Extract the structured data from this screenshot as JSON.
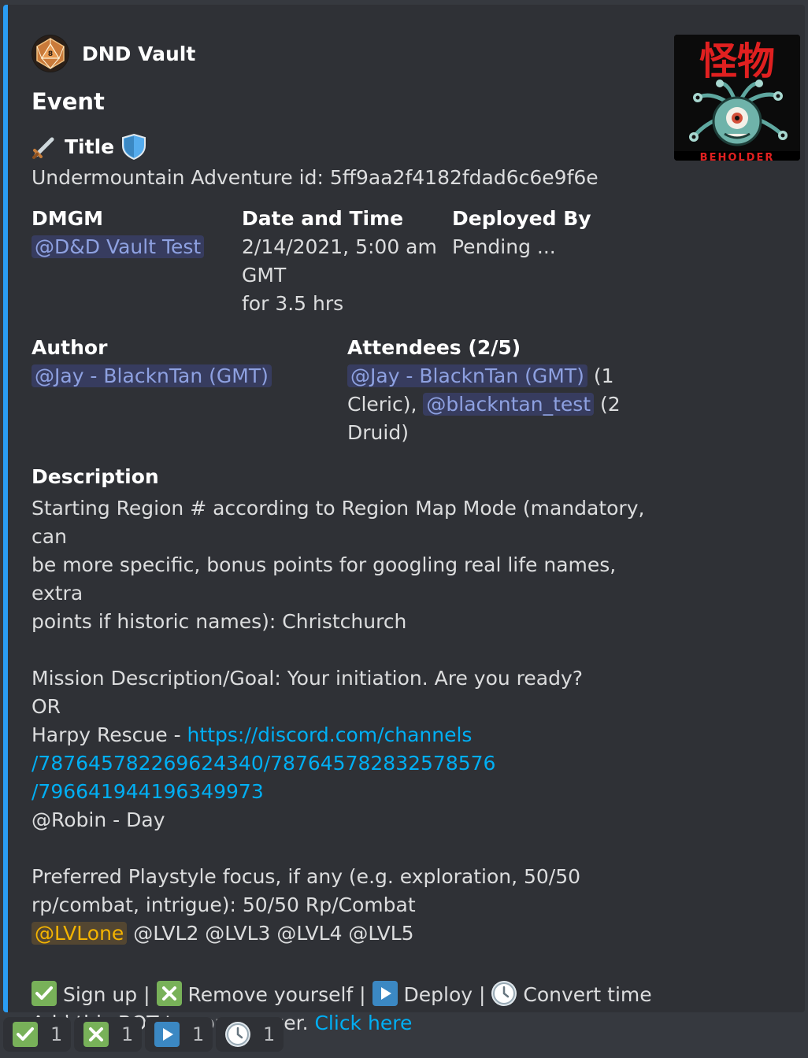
{
  "embed": {
    "accent_color": "#2a9df4",
    "author_name": "DND Vault",
    "author_icon": "d20-dice-icon",
    "title": "Event",
    "thumbnail_icon": "beholder-image",
    "thumbnail_text": "怪物",
    "thumbnail_caption": "BEHOLDER",
    "title_field": {
      "name": "Title",
      "value": "Undermountain Adventure id: 5ff9aa2f4182fdad6c6e9f6e"
    },
    "dmgm": {
      "name": "DMGM",
      "value": "@D&D Vault Test"
    },
    "date_time": {
      "name": "Date and Time",
      "line1": "2/14/2021, 5:00 am",
      "line2": "GMT",
      "line3": "for 3.5 hrs"
    },
    "deployed_by": {
      "name": "Deployed By",
      "value": "Pending ..."
    },
    "author_field": {
      "name": "Author",
      "value": "@Jay - BlacknTan (GMT)"
    },
    "attendees": {
      "name": "Attendees (2/5)",
      "m1": "@Jay - BlacknTan (GMT)",
      "t1a": "(1",
      "t1b": "Cleric),",
      "m2": "@blackntan_test",
      "t2a": "(2",
      "t2b": "Druid)"
    },
    "description": {
      "name": "Description",
      "l1": "Starting Region # according to Region Map Mode (mandatory, can",
      "l2": "be more specific, bonus points for googling real life names, extra",
      "l3": "points if historic names): Christchurch",
      "l4": "Mission Description/Goal: Your initiation. Are you ready?",
      "l5": "OR",
      "l6a": "Harpy Rescue - ",
      "l6b": "https://discord.com/channels",
      "l7": "/787645782269624340/787645782832578576",
      "l8": "/796641944196349973",
      "l9": "@Robin - Day",
      "l10": "Preferred Playstyle focus, if any (e.g. exploration, 50/50",
      "l11": "rp/combat, intrigue): 50/50 Rp/Combat",
      "role_mention": "@LVLone",
      "l12": " @LVL2 @LVL3 @LVL4 @LVL5"
    },
    "actions": {
      "signup": "Sign up",
      "sep": "|",
      "remove": "Remove yourself",
      "deploy": "Deploy",
      "convert": "Convert time",
      "add_bot": "Add this BOT to your server. ",
      "click_here": "Click here"
    }
  },
  "reactions": [
    {
      "icon": "check-mark-icon",
      "count": "1"
    },
    {
      "icon": "cross-mark-icon",
      "count": "1"
    },
    {
      "icon": "play-button-icon",
      "count": "1"
    },
    {
      "icon": "clock-icon",
      "count": "1"
    }
  ]
}
